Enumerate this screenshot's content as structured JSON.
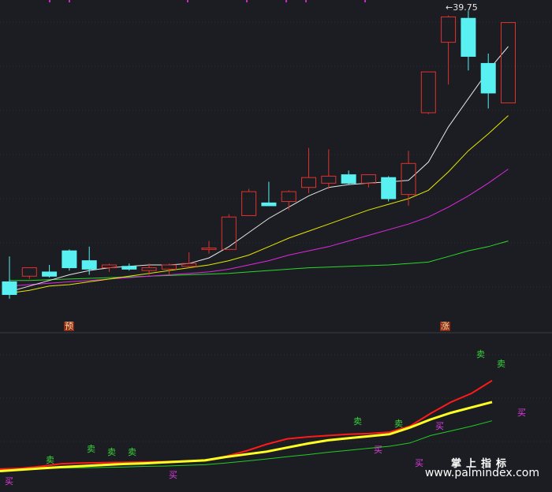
{
  "colors": {
    "background": "#1b1d22",
    "grid": "#2c2f36",
    "up": "#e0322d",
    "down": "#58f0f0",
    "ma5": "#e6e6e6",
    "ma10": "#e6e600",
    "ma20": "#e028e0",
    "ma60": "#2ad82a",
    "ind_red": "#ff1a1a",
    "ind_yellow": "#ffff22",
    "ind_green": "#22cc22"
  },
  "price_panel": {
    "peak_label": "←39.75",
    "tag_yu": "预",
    "tag_zhang": "涨"
  },
  "indicator_panel": {
    "sell_label": "卖",
    "buy_label": "买"
  },
  "watermark": {
    "brand": "掌上指标",
    "site": "www.palmindex.com"
  },
  "chart_data": {
    "type": "candlestick",
    "candles": [
      {
        "o": 20.5,
        "h": 22.3,
        "l": 19.3,
        "c": 19.6
      },
      {
        "o": 20.9,
        "h": 21.5,
        "l": 20.7,
        "c": 21.5
      },
      {
        "o": 21.2,
        "h": 21.7,
        "l": 20.8,
        "c": 20.9
      },
      {
        "o": 22.7,
        "h": 22.8,
        "l": 21.3,
        "c": 21.5
      },
      {
        "o": 22.0,
        "h": 23.0,
        "l": 21.0,
        "c": 21.4
      },
      {
        "o": 21.5,
        "h": 21.8,
        "l": 21.2,
        "c": 21.7
      },
      {
        "o": 21.6,
        "h": 21.8,
        "l": 21.3,
        "c": 21.4
      },
      {
        "o": 21.3,
        "h": 21.8,
        "l": 21.0,
        "c": 21.5
      },
      {
        "o": 21.4,
        "h": 21.8,
        "l": 21.0,
        "c": 21.7
      },
      {
        "o": 21.6,
        "h": 22.6,
        "l": 21.5,
        "c": 21.8
      },
      {
        "o": 22.8,
        "h": 23.4,
        "l": 22.5,
        "c": 22.9
      },
      {
        "o": 22.8,
        "h": 25.3,
        "l": 22.8,
        "c": 25.1
      },
      {
        "o": 25.2,
        "h": 27.1,
        "l": 25.2,
        "c": 26.9
      },
      {
        "o": 26.1,
        "h": 27.6,
        "l": 26.0,
        "c": 25.9
      },
      {
        "o": 26.2,
        "h": 27.0,
        "l": 25.6,
        "c": 26.9
      },
      {
        "o": 27.2,
        "h": 30.0,
        "l": 26.8,
        "c": 27.9
      },
      {
        "o": 27.5,
        "h": 29.9,
        "l": 27.1,
        "c": 28.0
      },
      {
        "o": 28.1,
        "h": 28.4,
        "l": 27.4,
        "c": 27.5
      },
      {
        "o": 27.5,
        "h": 28.1,
        "l": 27.2,
        "c": 28.1
      },
      {
        "o": 27.9,
        "h": 28.0,
        "l": 26.2,
        "c": 26.4
      },
      {
        "o": 26.7,
        "h": 29.8,
        "l": 25.9,
        "c": 28.9
      },
      {
        "o": 32.5,
        "h": 35.4,
        "l": 32.4,
        "c": 35.4
      },
      {
        "o": 37.5,
        "h": 39.4,
        "l": 34.5,
        "c": 39.3
      },
      {
        "o": 39.2,
        "h": 39.75,
        "l": 35.5,
        "c": 36.5
      },
      {
        "o": 36.0,
        "h": 36.7,
        "l": 32.8,
        "c": 33.9
      },
      {
        "o": 33.2,
        "h": 38.9,
        "l": 33.2,
        "c": 38.9
      }
    ],
    "ma5": [
      19.8,
      20.2,
      20.6,
      21.0,
      21.3,
      21.5,
      21.6,
      21.7,
      21.7,
      21.8,
      22.2,
      23.0,
      24.0,
      25.0,
      25.8,
      26.6,
      27.2,
      27.4,
      27.5,
      27.6,
      27.7,
      29.0,
      31.5,
      33.5,
      35.5,
      37.2
    ],
    "ma10": [
      19.7,
      19.9,
      20.2,
      20.3,
      20.5,
      20.7,
      20.9,
      21.1,
      21.3,
      21.5,
      21.7,
      22.0,
      22.4,
      23.0,
      23.6,
      24.1,
      24.6,
      25.1,
      25.6,
      26.0,
      26.4,
      27.0,
      28.3,
      29.8,
      31.0,
      32.3
    ],
    "ma20": [
      20.2,
      20.3,
      20.4,
      20.5,
      20.6,
      20.7,
      20.8,
      20.9,
      21.0,
      21.1,
      21.2,
      21.4,
      21.7,
      22.0,
      22.4,
      22.7,
      23.0,
      23.4,
      23.8,
      24.2,
      24.6,
      25.1,
      25.8,
      26.6,
      27.5,
      28.5
    ],
    "ma60": [
      20.6,
      20.6,
      20.65,
      20.7,
      20.75,
      20.8,
      20.85,
      20.9,
      20.95,
      21.0,
      21.05,
      21.1,
      21.2,
      21.3,
      21.4,
      21.5,
      21.55,
      21.6,
      21.65,
      21.7,
      21.8,
      21.9,
      22.3,
      22.7,
      23.0,
      23.4
    ],
    "indicator": {
      "red": [
        0.6,
        0.7,
        1.0,
        1.4,
        1.5,
        1.55,
        1.6,
        1.65,
        1.7,
        1.8,
        1.9,
        2.5,
        3.3,
        4.3,
        5.1,
        5.4,
        5.6,
        5.8,
        5.9,
        6.1,
        7.0,
        8.9,
        10.6,
        11.9,
        13.8
      ],
      "yellow": [
        0.3,
        0.5,
        0.7,
        0.9,
        1.05,
        1.2,
        1.35,
        1.45,
        1.6,
        1.75,
        1.9,
        2.4,
        2.8,
        3.2,
        3.8,
        4.4,
        4.9,
        5.2,
        5.5,
        5.8,
        6.8,
        8.0,
        9.0,
        9.8,
        10.6
      ],
      "green": [
        0.5,
        0.6,
        0.7,
        0.75,
        0.8,
        0.85,
        0.9,
        1.0,
        1.05,
        1.15,
        1.25,
        1.5,
        1.8,
        2.1,
        2.45,
        2.75,
        3.1,
        3.4,
        3.7,
        4.0,
        4.5,
        5.6,
        6.3,
        7.0,
        7.8
      ],
      "ylim": [
        0,
        20
      ],
      "sell_signals": [
        [
          2,
          1.9
        ],
        [
          4,
          3.5
        ],
        [
          5,
          3.1
        ],
        [
          6,
          3.1
        ],
        [
          17,
          7.6
        ],
        [
          19,
          7.3
        ],
        [
          23,
          17.7
        ],
        [
          24,
          16.2
        ]
      ],
      "buy_signals": [
        [
          0,
          -1.3
        ],
        [
          8,
          -0.4
        ],
        [
          18,
          3.4
        ],
        [
          20,
          1.4
        ],
        [
          21,
          6.9
        ],
        [
          25,
          8.9
        ]
      ]
    }
  }
}
